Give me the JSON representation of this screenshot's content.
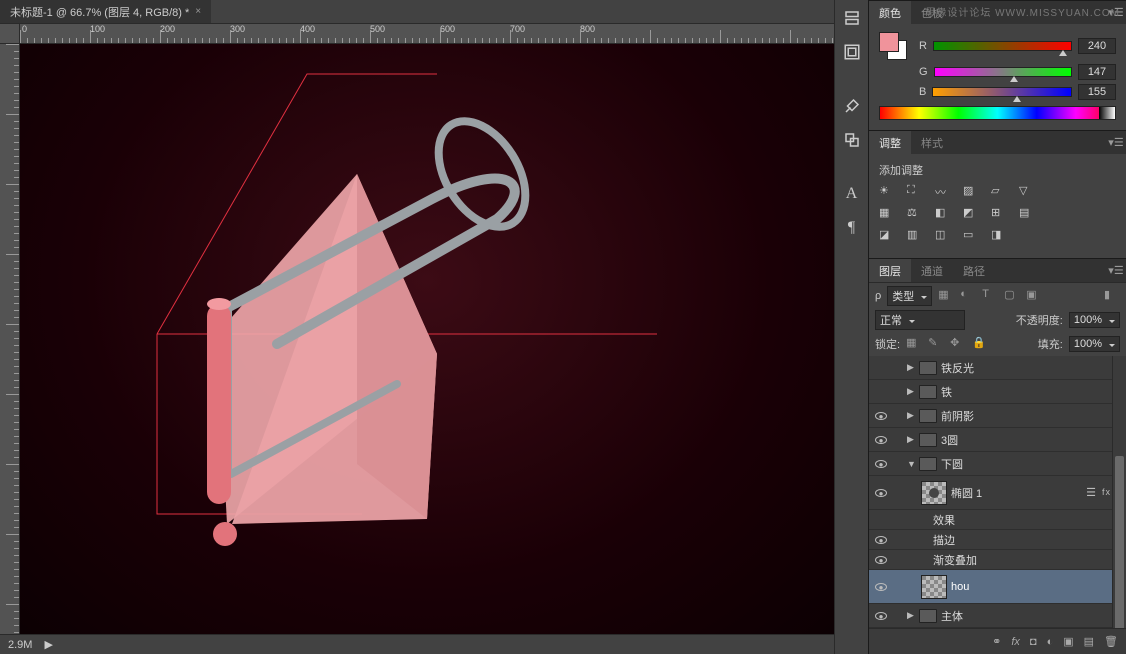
{
  "document": {
    "tab_title": "未标题-1 @ 66.7% (图层 4, RGB/8) *"
  },
  "ruler": {
    "marks": [
      "0",
      "100",
      "200",
      "300",
      "400",
      "500",
      "600",
      "700",
      "800"
    ]
  },
  "status": {
    "zoom": "2.9M",
    "arrow": "▶"
  },
  "panels": {
    "color": {
      "tab_color": "颜色",
      "tab_swatches": "色板",
      "labels": {
        "r": "R",
        "g": "G",
        "b": "B"
      },
      "values": {
        "r": "240",
        "g": "147",
        "b": "155"
      },
      "watermark": "思缘设计论坛  WWW.MISSYUAN.COM"
    },
    "adjust": {
      "tab_adjust": "调整",
      "tab_styles": "样式",
      "add_label": "添加调整"
    },
    "layers": {
      "tab_layers": "图层",
      "tab_channels": "通道",
      "tab_paths": "路径",
      "filter_label": "类型",
      "blend_mode": "正常",
      "opacity_label": "不透明度:",
      "opacity_value": "100%",
      "lock_label": "锁定:",
      "fill_label": "填充:",
      "fill_value": "100%",
      "items": [
        {
          "name": "铁反光",
          "type": "folder",
          "vis": false
        },
        {
          "name": "铁",
          "type": "folder",
          "vis": false
        },
        {
          "name": "前阴影",
          "type": "folder",
          "vis": true
        },
        {
          "name": "3圆",
          "type": "folder",
          "vis": true
        },
        {
          "name": "下圆",
          "type": "folder-open",
          "vis": true
        },
        {
          "name": "椭圆 1",
          "type": "shape",
          "vis": true,
          "indent": 2,
          "fx": true
        },
        {
          "name": "效果",
          "type": "label",
          "indent": 3
        },
        {
          "name": "描边",
          "type": "fx-item",
          "indent": 3,
          "vis": true
        },
        {
          "name": "渐变叠加",
          "type": "fx-item",
          "indent": 3,
          "vis": true
        },
        {
          "name": "hou",
          "type": "shape",
          "vis": true,
          "indent": 2,
          "selected": true
        },
        {
          "name": "主体",
          "type": "folder",
          "vis": true
        }
      ],
      "footer_icons": [
        "link",
        "fx",
        "mask",
        "adjust",
        "group",
        "new",
        "trash"
      ]
    }
  }
}
